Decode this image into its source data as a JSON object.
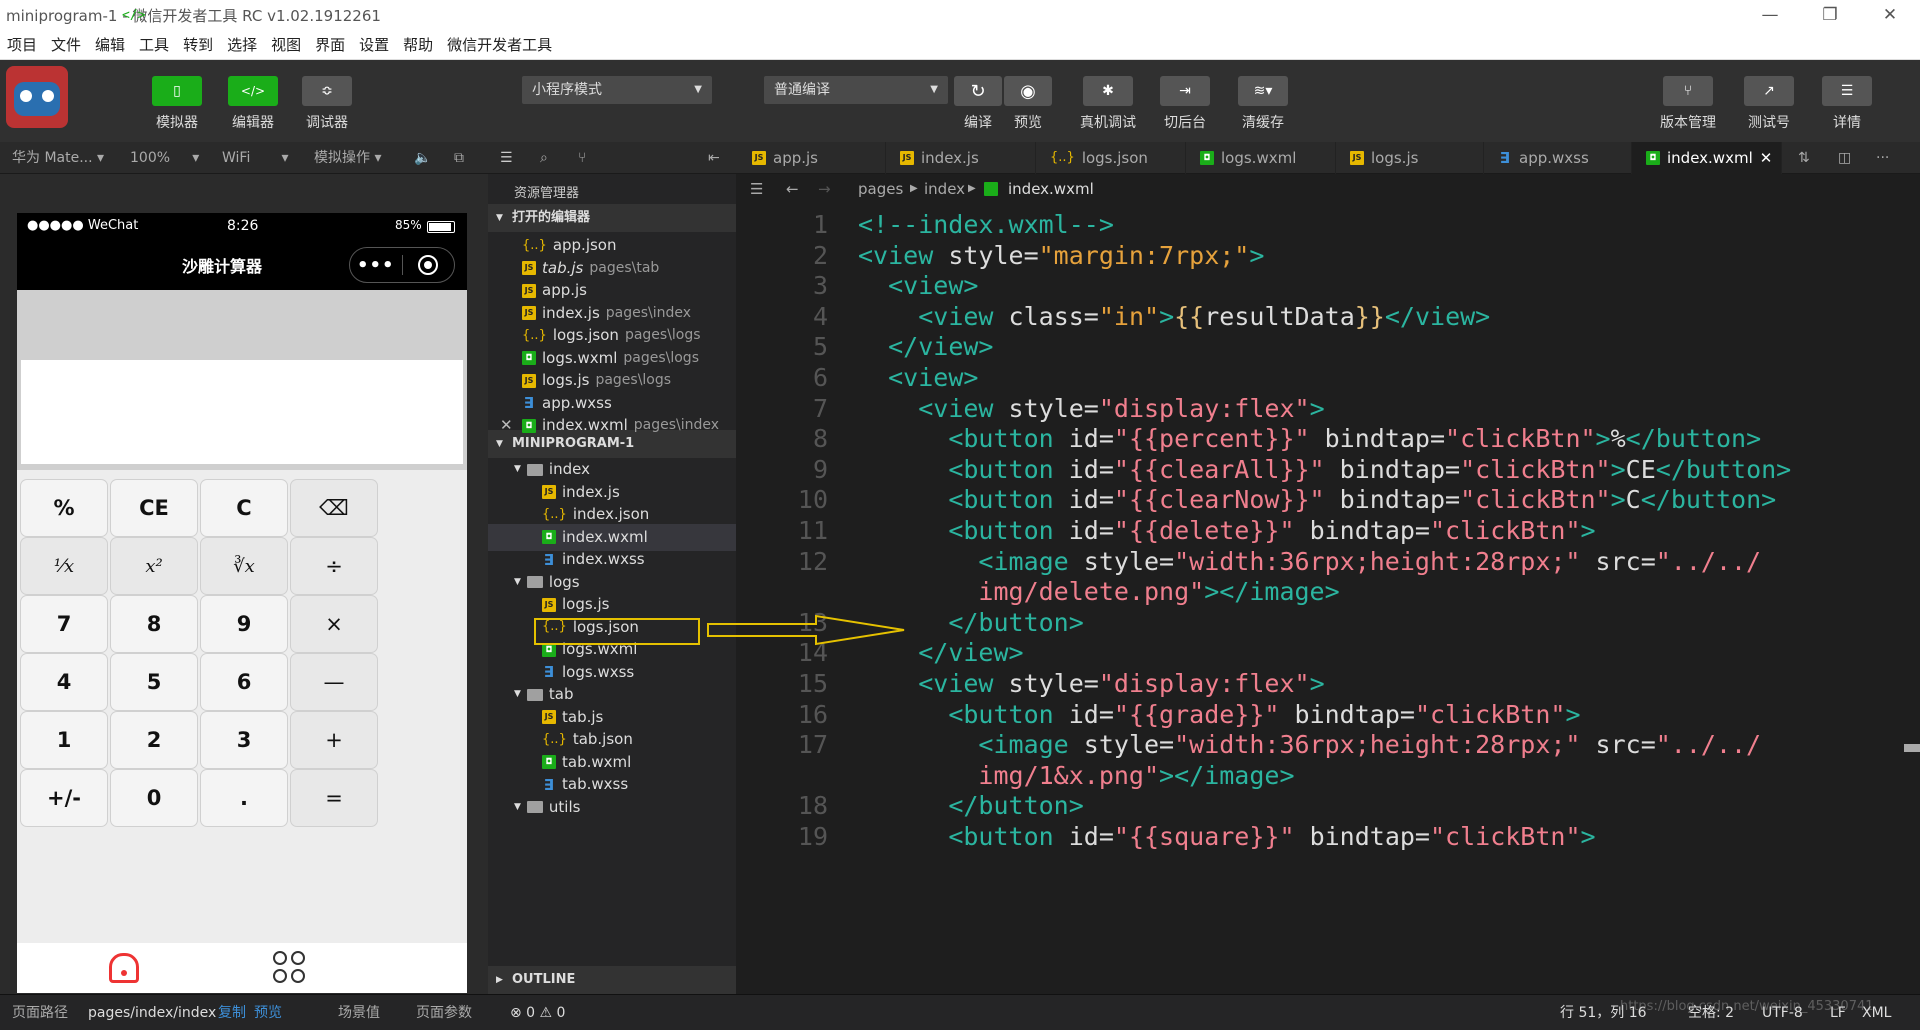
{
  "window": {
    "title": "miniprogram-1 - 微信开发者工具 RC v1.02.1912261",
    "icon": "</>"
  },
  "menu": [
    "项目",
    "文件",
    "编辑",
    "工具",
    "转到",
    "选择",
    "视图",
    "界面",
    "设置",
    "帮助",
    "微信开发者工具"
  ],
  "toolbar": {
    "simulator": "模拟器",
    "editor": "编辑器",
    "debugger": "调试器",
    "mode": "小程序模式",
    "compile": "普通编译",
    "compile_btn": "编译",
    "preview_btn": "预览",
    "remote_debug": "真机调试",
    "backend": "切后台",
    "clear_cache": "清缓存",
    "version": "版本管理",
    "test_account": "测试号",
    "details": "详情",
    "edit_icon": "</>"
  },
  "simbar": {
    "device": "华为 Mate...",
    "zoom": "100%",
    "network": "WiFi",
    "ops": "模拟操作"
  },
  "tabs": [
    "app.js",
    "index.js",
    "logs.json",
    "logs.wxml",
    "logs.js",
    "app.wxss",
    "index.wxml"
  ],
  "phone": {
    "carrier": "●●●●● WeChat",
    "time": "8:26",
    "battery": "85%",
    "title": "沙雕计算器",
    "keys": [
      [
        "%",
        "CE",
        "C",
        "⌫"
      ],
      [
        "¹⁄x",
        "x²",
        "∛x",
        "÷"
      ],
      [
        "7",
        "8",
        "9",
        "×"
      ],
      [
        "4",
        "5",
        "6",
        "—"
      ],
      [
        "1",
        "2",
        "3",
        "+"
      ],
      [
        "+/-",
        "0",
        ".",
        "="
      ]
    ]
  },
  "explorer": {
    "title": "资源管理器",
    "open_section": "打开的编辑器",
    "open_files": [
      {
        "name": "app.json",
        "path": "",
        "type": "json"
      },
      {
        "name": "tab.js",
        "path": "pages\\tab",
        "type": "js"
      },
      {
        "name": "app.js",
        "path": "",
        "type": "js"
      },
      {
        "name": "index.js",
        "path": "pages\\index",
        "type": "js"
      },
      {
        "name": "logs.json",
        "path": "pages\\logs",
        "type": "json"
      },
      {
        "name": "logs.wxml",
        "path": "pages\\logs",
        "type": "wxml"
      },
      {
        "name": "logs.js",
        "path": "pages\\logs",
        "type": "js"
      },
      {
        "name": "app.wxss",
        "path": "",
        "type": "wxss"
      },
      {
        "name": "index.wxml",
        "path": "pages\\index",
        "type": "wxml"
      }
    ],
    "project_section": "MINIPROGRAM-1",
    "tree": [
      {
        "name": "index",
        "type": "folder",
        "depth": 1
      },
      {
        "name": "index.js",
        "type": "js",
        "depth": 2
      },
      {
        "name": "index.json",
        "type": "json",
        "depth": 2
      },
      {
        "name": "index.wxml",
        "type": "wxml",
        "depth": 2
      },
      {
        "name": "index.wxss",
        "type": "wxss",
        "depth": 2
      },
      {
        "name": "logs",
        "type": "folder",
        "depth": 1
      },
      {
        "name": "logs.js",
        "type": "js",
        "depth": 2
      },
      {
        "name": "logs.json",
        "type": "json",
        "depth": 2
      },
      {
        "name": "logs.wxml",
        "type": "wxml",
        "depth": 2
      },
      {
        "name": "logs.wxss",
        "type": "wxss",
        "depth": 2
      },
      {
        "name": "tab",
        "type": "folder",
        "depth": 1
      },
      {
        "name": "tab.js",
        "type": "js",
        "depth": 2
      },
      {
        "name": "tab.json",
        "type": "json",
        "depth": 2
      },
      {
        "name": "tab.wxml",
        "type": "wxml",
        "depth": 2
      },
      {
        "name": "tab.wxss",
        "type": "wxss",
        "depth": 2
      },
      {
        "name": "utils",
        "type": "folder",
        "depth": 1
      }
    ],
    "outline": "OUTLINE"
  },
  "breadcrumb": [
    "pages",
    "index",
    "index.wxml"
  ],
  "code": [
    {
      "n": "1",
      "html": "<span class='cmt'>&lt;!--index.wxml--&gt;</span>"
    },
    {
      "n": "2",
      "html": "<span class='tagc'>&lt;view</span> style=<span class='str'>\"margin:7rpx;\"</span><span class='tagc'>&gt;</span>"
    },
    {
      "n": "3",
      "html": "  <span class='tagc'>&lt;view&gt;</span>"
    },
    {
      "n": "4",
      "html": "    <span class='tagc'>&lt;view</span> class=<span class='str'>\"in\"</span><span class='tagc'>&gt;</span><span class='brace'>{{</span>resultData<span class='brace'>}}</span><span class='tagc'>&lt;/view&gt;</span>"
    },
    {
      "n": "5",
      "html": "  <span class='tagc'>&lt;/view&gt;</span>"
    },
    {
      "n": "6",
      "html": "  <span class='tagc'>&lt;view&gt;</span>"
    },
    {
      "n": "7",
      "html": "    <span class='tagc'>&lt;view</span> style=<span class='strp'>\"display:flex\"</span><span class='tagc'>&gt;</span>"
    },
    {
      "n": "8",
      "html": "      <span class='tagc'>&lt;button</span> id=<span class='strp'>\"{{percent}}\"</span> bindtap=<span class='strp'>\"clickBtn\"</span><span class='tagc'>&gt;</span>%<span class='tagc'>&lt;/button&gt;</span>"
    },
    {
      "n": "9",
      "html": "      <span class='tagc'>&lt;button</span> id=<span class='strp'>\"{{clearAll}}\"</span> bindtap=<span class='strp'>\"clickBtn\"</span><span class='tagc'>&gt;</span>CE<span class='tagc'>&lt;/button&gt;</span>"
    },
    {
      "n": "10",
      "html": "      <span class='tagc'>&lt;button</span> id=<span class='strp'>\"{{clearNow}}\"</span> bindtap=<span class='strp'>\"clickBtn\"</span><span class='tagc'>&gt;</span>C<span class='tagc'>&lt;/button&gt;</span>"
    },
    {
      "n": "11",
      "html": "      <span class='tagc'>&lt;button</span> id=<span class='strp'>\"{{delete}}\"</span> bindtap=<span class='strp'>\"clickBtn\"</span><span class='tagc'>&gt;</span>"
    },
    {
      "n": "12",
      "html": "        <span class='tagc'>&lt;image</span> style=<span class='strp'>\"width:36rpx;height:28rpx;\"</span> src=<span class='strp'>\"../../</span>"
    },
    {
      "n": "",
      "html": "        <span class='strp'>img/delete.png\"</span><span class='tagc'>&gt;&lt;/image&gt;</span>"
    },
    {
      "n": "13",
      "html": "      <span class='tagc'>&lt;/button&gt;</span>"
    },
    {
      "n": "14",
      "html": "    <span class='tagc'>&lt;/view&gt;</span>"
    },
    {
      "n": "15",
      "html": "    <span class='tagc'>&lt;view</span> style=<span class='strp'>\"display:flex\"</span><span class='tagc'>&gt;</span>"
    },
    {
      "n": "16",
      "html": "      <span class='tagc'>&lt;button</span> id=<span class='strp'>\"{{grade}}\"</span> bindtap=<span class='strp'>\"clickBtn\"</span><span class='tagc'>&gt;</span>"
    },
    {
      "n": "17",
      "html": "        <span class='tagc'>&lt;image</span> style=<span class='strp'>\"width:36rpx;height:28rpx;\"</span> src=<span class='strp'>\"../../</span>"
    },
    {
      "n": "",
      "html": "        <span class='strp'>img/1&amp;x.png\"</span><span class='tagc'>&gt;&lt;/image&gt;</span>"
    },
    {
      "n": "18",
      "html": "      <span class='tagc'>&lt;/button&gt;</span>"
    },
    {
      "n": "19",
      "html": "      <span class='tagc'>&lt;button</span> id=<span class='strp'>\"{{square}}\"</span> bindtap=<span class='strp'>\"clickBtn\"</span><span class='tagc'>&gt;</span>"
    }
  ],
  "status": {
    "path_label": "页面路径",
    "path": "pages/index/index",
    "copy": "复制",
    "preview": "预览",
    "scene": "场景值",
    "params": "页面参数",
    "errors": "⊗ 0 ⚠ 0",
    "position": "行 51，列 16",
    "spaces": "空格: 2",
    "encoding": "UTF-8",
    "eol": "LF",
    "lang": "XML",
    "watermark": "https://blog.csdn.net/weixin_45330741"
  },
  "colors": {
    "accent": "#1aad19",
    "highlight": "#e5c100"
  }
}
